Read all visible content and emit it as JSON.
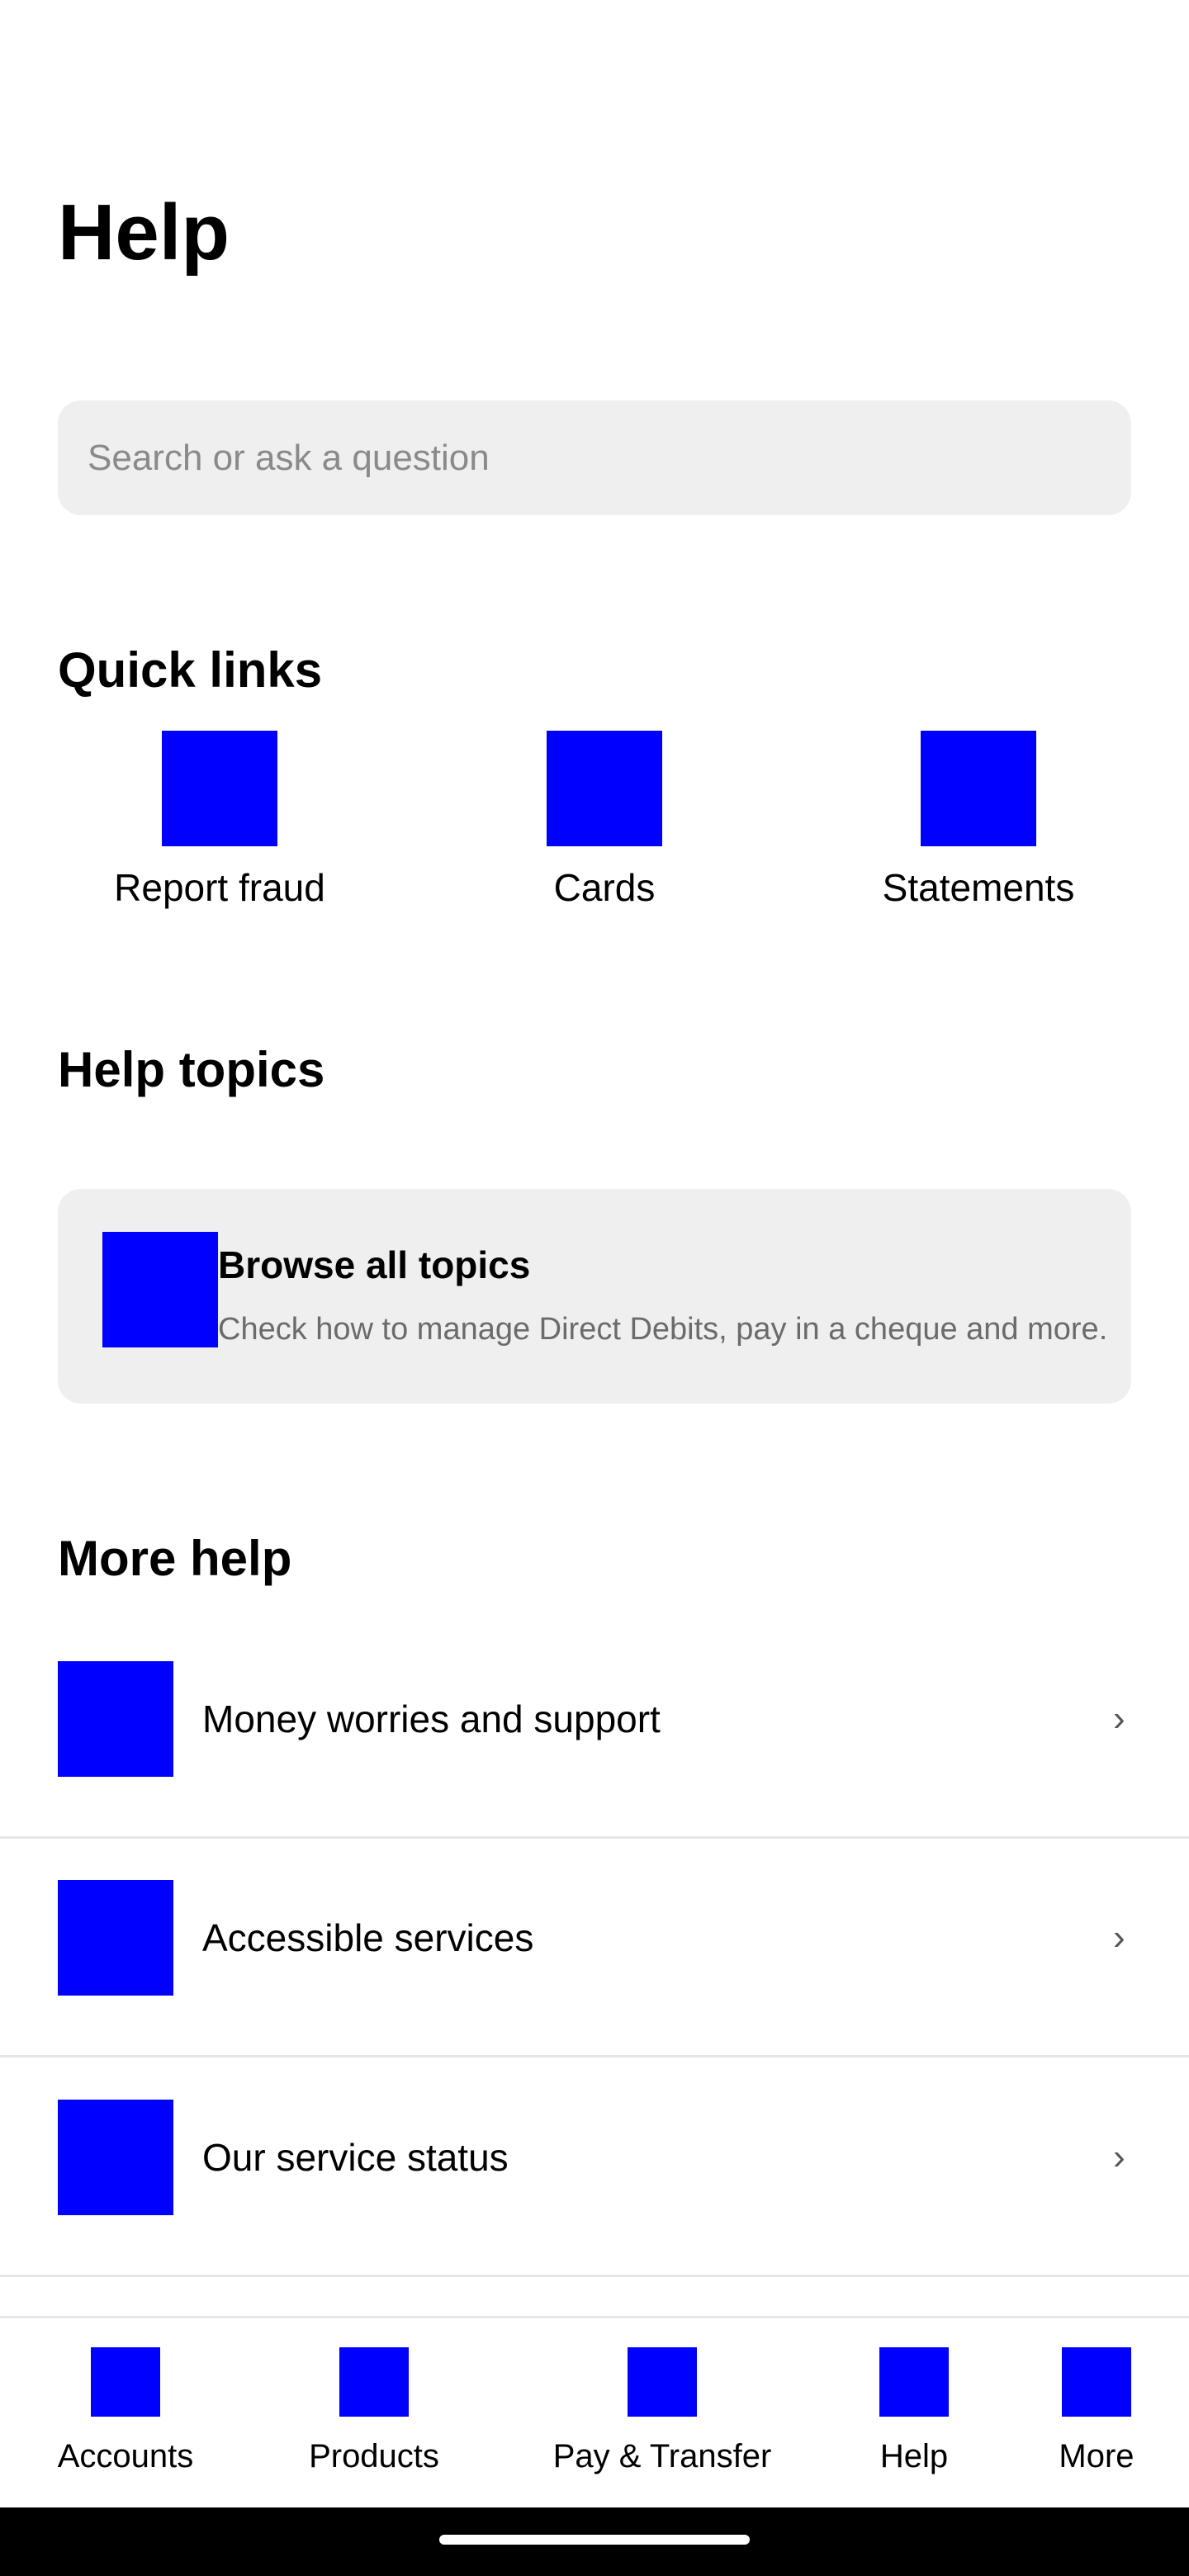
{
  "header": {
    "title": "Help"
  },
  "search": {
    "placeholder": "Search or ask a question",
    "value": ""
  },
  "quick_links": {
    "title": "Quick links",
    "items": [
      {
        "label": "Report fraud",
        "icon": "report-fraud-icon"
      },
      {
        "label": "Cards",
        "icon": "cards-icon"
      },
      {
        "label": "Statements",
        "icon": "statements-icon"
      }
    ]
  },
  "help_topics": {
    "title": "Help topics",
    "card": {
      "title": "Browse all topics",
      "subtitle": "Check how to manage Direct Debits, pay in a cheque and more.",
      "icon": "browse-topics-icon",
      "chevron": "›"
    }
  },
  "more_help": {
    "title": "More help",
    "items": [
      {
        "label": "Money worries and support",
        "icon": "money-worries-icon",
        "chevron": "›"
      },
      {
        "label": "Accessible services",
        "icon": "accessible-services-icon",
        "chevron": "›"
      },
      {
        "label": "Our service status",
        "icon": "service-status-icon",
        "chevron": "›"
      }
    ]
  },
  "bottom_nav": {
    "items": [
      {
        "label": "Accounts",
        "icon": "accounts-icon"
      },
      {
        "label": "Products",
        "icon": "products-icon"
      },
      {
        "label": "Pay & Transfer",
        "icon": "pay-transfer-icon"
      },
      {
        "label": "Help",
        "icon": "help-icon"
      },
      {
        "label": "More",
        "icon": "more-icon"
      }
    ]
  },
  "colors": {
    "icon_placeholder": "#0000ff",
    "card_background": "#efefef",
    "text_primary": "#000000",
    "text_secondary": "#6b6b6b"
  }
}
